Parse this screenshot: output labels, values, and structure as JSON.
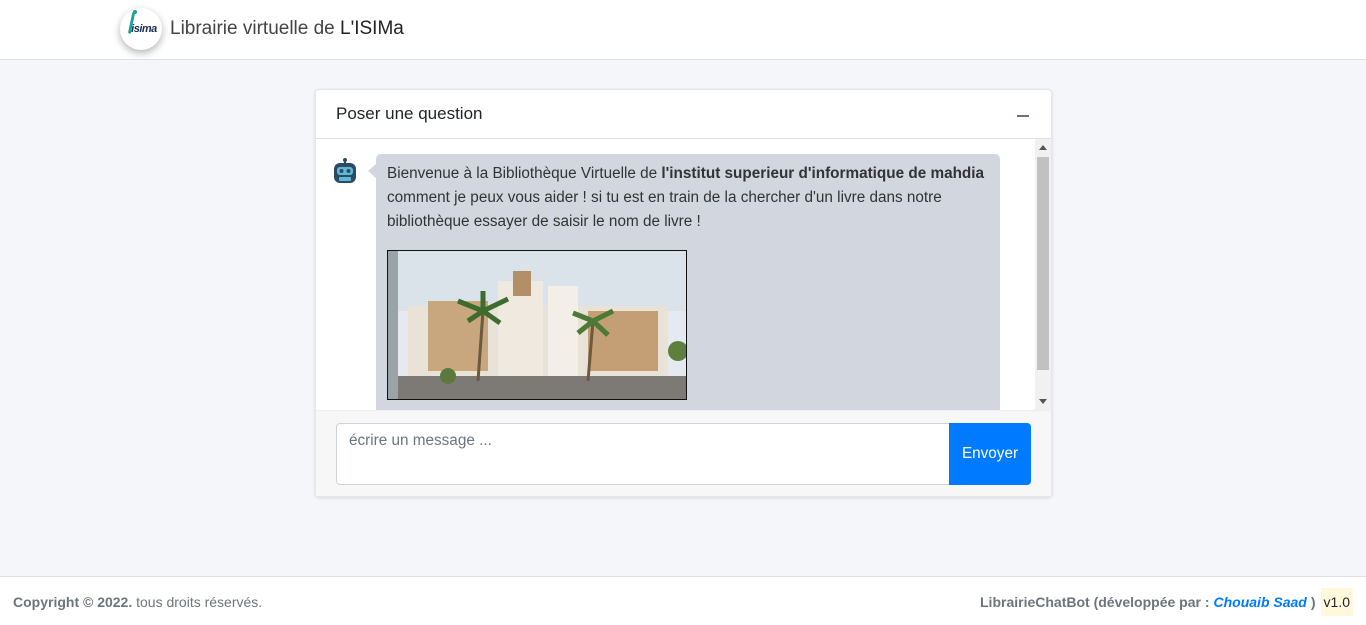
{
  "navbar": {
    "logo_text": "isima",
    "title_prefix": "Librairie virtuelle de ",
    "title_strong": "L'ISIMa"
  },
  "chat": {
    "header_title": "Poser une question",
    "bot_message": {
      "part1": "Bienvenue à la Bibliothèque Virtuelle de ",
      "bold": "l'institut superieur d'informatique de mahdia",
      "part2": " comment je peux vous aider ! si tu est en train de la chercher d'un livre dans notre bibliothèque essayer de saisir le nom de livre !"
    },
    "input_placeholder": "écrire un message ...",
    "send_label": "Envoyer"
  },
  "footer": {
    "copyright_bold": "Copyright © 2022.",
    "copyright_rest": " tous droits réservés.",
    "app_name": "LibrairieChatBot",
    "dev_prefix": "(développée par :",
    "author": "Chouaib Saad",
    "dev_suffix": ")",
    "version": "v1.0"
  },
  "colors": {
    "primary": "#007bff",
    "bubble": "#d2d6de",
    "page_bg": "#f4f6f9"
  }
}
